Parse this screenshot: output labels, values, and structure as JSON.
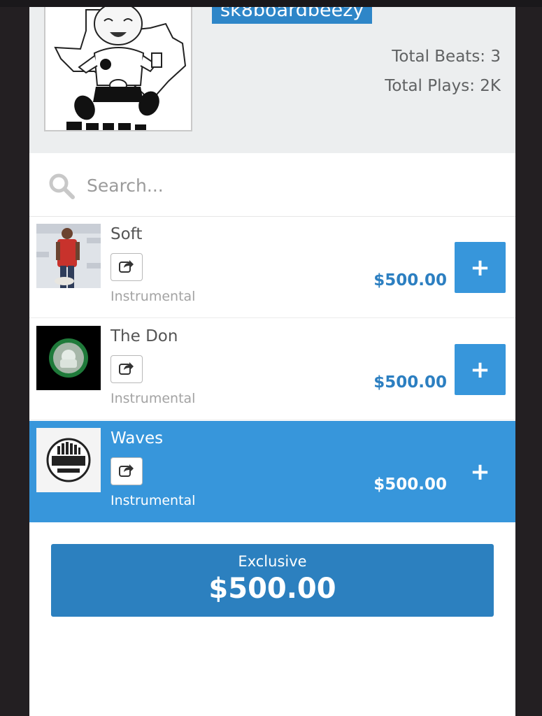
{
  "profile": {
    "username": "sk8boardbeezy",
    "total_beats": "Total Beats: 3",
    "total_plays": "Total Plays: 2K"
  },
  "search": {
    "placeholder": "Search..."
  },
  "beats": [
    {
      "title": "Soft",
      "type": "Instrumental",
      "price": "$500.00",
      "add_label": "+",
      "selected": false
    },
    {
      "title": "The Don",
      "type": "Instrumental",
      "price": "$500.00",
      "add_label": "+",
      "selected": false
    },
    {
      "title": "Waves",
      "type": "Instrumental",
      "price": "$500.00",
      "add_label": "+",
      "selected": true
    }
  ],
  "exclusive": {
    "label": "Exclusive",
    "price": "$500.00"
  },
  "icons": {
    "search": "search-icon",
    "share": "share-icon",
    "add": "plus-icon"
  },
  "colors": {
    "accent": "#3796db",
    "price_blue": "#2c7fc1",
    "header_bg": "#eceeef",
    "frame_dark": "#231f22"
  }
}
